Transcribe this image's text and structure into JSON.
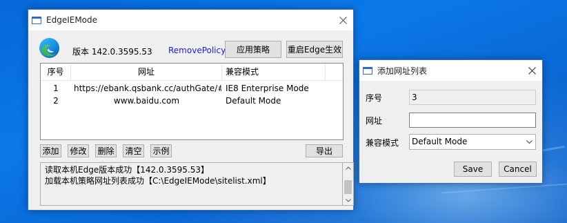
{
  "main_window": {
    "title": "EdgeIEMode",
    "version_label": "版本 142.0.3595.53",
    "remove_policy_link": "RemovePolicy",
    "apply_policy_button": "应用策略",
    "restart_edge_button": "重启Edge生效",
    "table": {
      "columns": [
        "序号",
        "网址",
        "兼容模式"
      ],
      "rows": [
        [
          "1",
          "https://ebank.qsbank.cc/authGate/#L...",
          "IE8 Enterprise Mode"
        ],
        [
          "2",
          "www.baidu.com",
          "Default Mode"
        ]
      ]
    },
    "actions": {
      "add": "添加",
      "edit": "修改",
      "delete": "删除",
      "clear": "清空",
      "example": "示例",
      "export": "导出"
    },
    "log": [
      "读取本机Edge版本成功【142.0.3595.53】",
      "加载本机策略网址列表成功【C:\\EdgeIEMode\\sitelist.xml】"
    ]
  },
  "dialog": {
    "title": "添加网址列表",
    "index_label": "序号",
    "index_value": "3",
    "url_label": "网址",
    "url_value": "",
    "mode_label": "兼容模式",
    "mode_value": "Default Mode",
    "save_button": "Save",
    "cancel_button": "Cancel"
  },
  "icons": {
    "app": "window-icon",
    "edge": "edge-logo-icon",
    "close": "close-icon",
    "dropdown": "chevron-down-icon"
  },
  "colors": {
    "accent": "#2b6bd1",
    "link": "#1a1ad6",
    "desktop": "#0a62d6"
  }
}
